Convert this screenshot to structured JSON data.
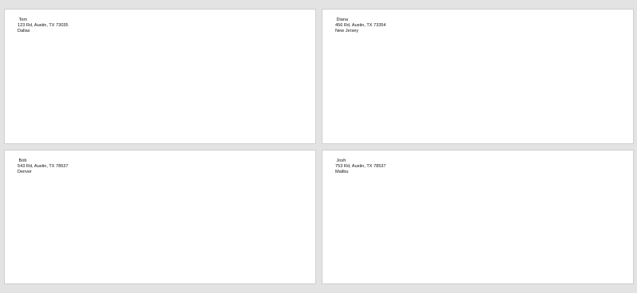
{
  "document": {
    "pages": [
      {
        "name": "Tom",
        "street": "123 Rd, Austin, TX 73035",
        "city": "Dallas"
      },
      {
        "name": "Diana",
        "street": "456 Rd, Austin, TX 73354",
        "city": "New Jersey"
      },
      {
        "name": "Bob",
        "street": "543 Rd, Austin, TX 78637",
        "city": "Denver"
      },
      {
        "name": "Josh",
        "street": "753 Rd, Austin, TX 78537",
        "city": "Malibu"
      }
    ]
  },
  "colors": {
    "workspace_background": "#e3e3e3",
    "page_background": "#ffffff",
    "text": "#111111"
  }
}
